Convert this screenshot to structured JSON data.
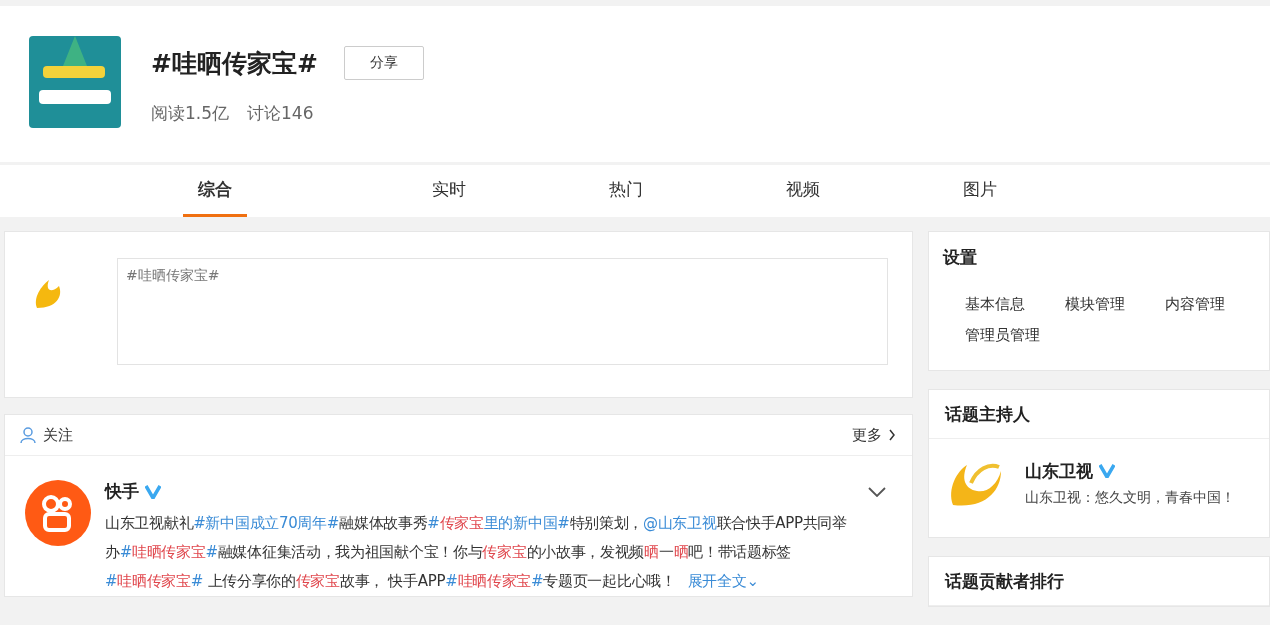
{
  "topic": {
    "title": "#哇晒传家宝#",
    "share_button": "分享",
    "stats": [
      "阅读1.5亿",
      "讨论146"
    ]
  },
  "tabs": [
    {
      "label": "综合",
      "selected": true
    },
    {
      "label": "实时",
      "selected": false
    },
    {
      "label": "热门",
      "selected": false
    },
    {
      "label": "视频",
      "selected": false
    },
    {
      "label": "图片",
      "selected": false
    }
  ],
  "composer": {
    "placeholder": "#哇晒传家宝#"
  },
  "feed": {
    "header": "关注",
    "more": "更多",
    "post": {
      "author": "快手",
      "verified": true,
      "body": [
        {
          "kind": "text",
          "parts": [
            {
              "text": "山东卫视献礼",
              "hl": false
            }
          ]
        },
        {
          "kind": "link",
          "parts": [
            {
              "text": "#新中国成立70周年#",
              "hl": false
            }
          ]
        },
        {
          "kind": "text",
          "parts": [
            {
              "text": "融媒体故事秀",
              "hl": false
            }
          ]
        },
        {
          "kind": "link",
          "parts": [
            {
              "text": "#",
              "hl": false
            },
            {
              "text": "传家宝",
              "hl": true
            },
            {
              "text": "里的新中国#",
              "hl": false
            }
          ]
        },
        {
          "kind": "text",
          "parts": [
            {
              "text": "特别策划，",
              "hl": false
            }
          ]
        },
        {
          "kind": "link",
          "parts": [
            {
              "text": "@山东卫视",
              "hl": false
            }
          ]
        },
        {
          "kind": "text",
          "parts": [
            {
              "text": "联合快手APP共同举办",
              "hl": false
            }
          ]
        },
        {
          "kind": "link",
          "parts": [
            {
              "text": "#",
              "hl": false
            },
            {
              "text": "哇晒传家宝",
              "hl": true
            },
            {
              "text": "#",
              "hl": false
            }
          ]
        },
        {
          "kind": "text",
          "parts": [
            {
              "text": "融媒体征集活动，我为祖国献个宝！你与",
              "hl": false
            },
            {
              "text": "传家宝",
              "hl": true
            },
            {
              "text": "的小故事，发视频",
              "hl": false
            },
            {
              "text": "晒",
              "hl": true
            },
            {
              "text": "一",
              "hl": false
            },
            {
              "text": "晒",
              "hl": true
            },
            {
              "text": "吧！带话题标签",
              "hl": false
            }
          ]
        },
        {
          "kind": "link",
          "parts": [
            {
              "text": "#",
              "hl": false
            },
            {
              "text": "哇晒传家宝",
              "hl": true
            },
            {
              "text": "#",
              "hl": false
            }
          ]
        },
        {
          "kind": "text",
          "parts": [
            {
              "text": " 上传分享你的",
              "hl": false
            },
            {
              "text": "传家宝",
              "hl": true
            },
            {
              "text": "故事， 快手APP",
              "hl": false
            }
          ]
        },
        {
          "kind": "link",
          "parts": [
            {
              "text": "#",
              "hl": false
            },
            {
              "text": "哇晒传家宝",
              "hl": true
            },
            {
              "text": "#",
              "hl": false
            }
          ]
        },
        {
          "kind": "text",
          "parts": [
            {
              "text": "专题页一起比心哦！",
              "hl": false
            }
          ]
        },
        {
          "kind": "expand",
          "parts": [
            {
              "text": "展开全文",
              "hl": false
            },
            {
              "text": "⌄",
              "hl": false
            }
          ]
        }
      ]
    }
  },
  "settings": {
    "title": "设置",
    "items": [
      "基本信息",
      "模块管理",
      "内容管理",
      "管理员管理"
    ]
  },
  "host": {
    "title": "话题主持人",
    "name": "山东卫视",
    "verified": true,
    "slogan": "山东卫视：悠久文明，青春中国！"
  },
  "contributors": {
    "title": "话题贡献者排行"
  }
}
